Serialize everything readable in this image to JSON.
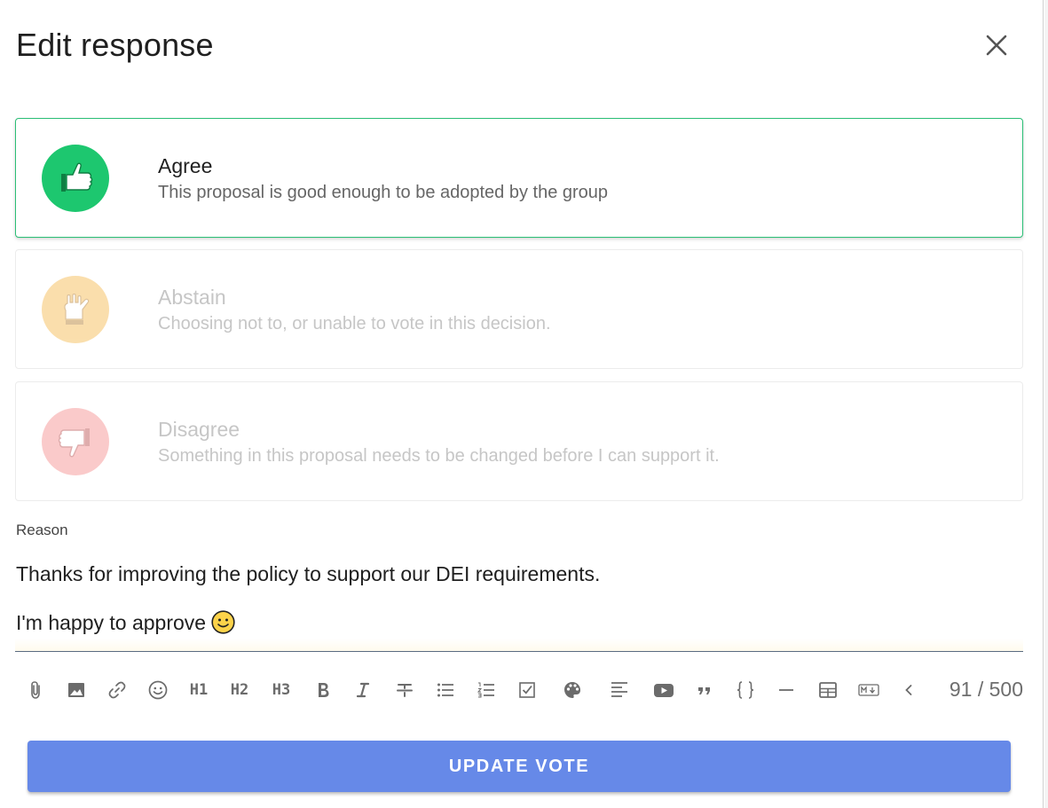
{
  "dialog": {
    "title": "Edit response",
    "close_icon": "close-icon"
  },
  "options": [
    {
      "label": "Agree",
      "description": "This proposal is good enough to be adopted by the group",
      "icon": "thumbs-up-icon",
      "color": "#1dc76f",
      "selected": true
    },
    {
      "label": "Abstain",
      "description": "Choosing not to, or unable to vote in this decision.",
      "icon": "thumbs-sideways-icon",
      "color": "#f5b74a",
      "selected": false
    },
    {
      "label": "Disagree",
      "description": "Something in this proposal needs to be changed before I can support it.",
      "icon": "thumbs-down-icon",
      "color": "#f68c8c",
      "selected": false
    }
  ],
  "reason": {
    "label": "Reason",
    "paragraphs": [
      "Thanks for improving the policy to support our DEI requirements.",
      "I'm happy to approve"
    ],
    "emoji": "slightly-smiling-face-icon"
  },
  "toolbar": {
    "h1": "H1",
    "h2": "H2",
    "h3": "H3",
    "counter": "91 / 500",
    "icons": [
      "attachment-icon",
      "image-icon",
      "link-icon",
      "emoji-icon",
      "heading-1-icon",
      "heading-2-icon",
      "heading-3-icon",
      "bold-icon",
      "italic-icon",
      "strikethrough-icon",
      "bullet-list-icon",
      "numbered-list-icon",
      "task-list-icon",
      "palette-icon",
      "align-icon",
      "youtube-icon",
      "quote-icon",
      "code-icon",
      "horizontal-rule-icon",
      "table-icon",
      "markdown-icon",
      "collapse-chevron-icon"
    ]
  },
  "submit": {
    "label": "UPDATE VOTE",
    "color": "#6689e8"
  }
}
